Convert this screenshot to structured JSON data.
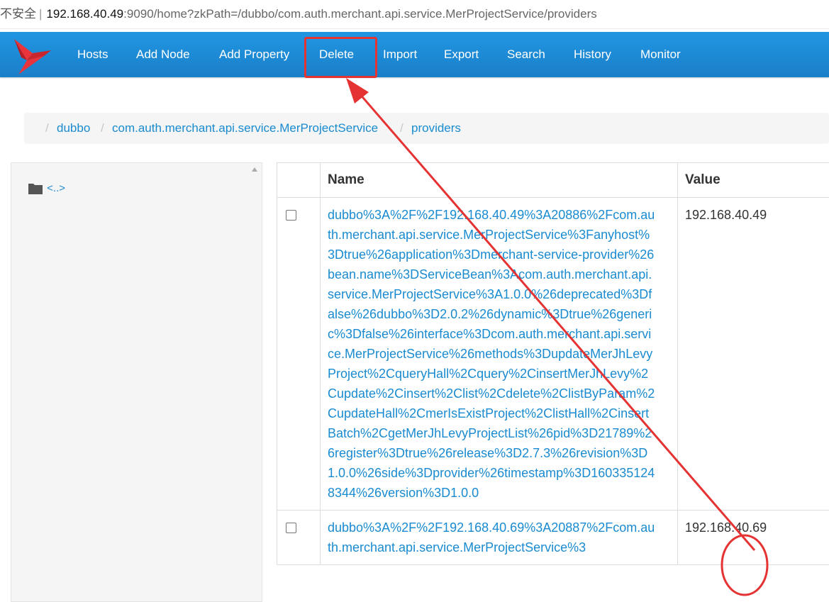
{
  "address_bar": {
    "security_label": "不安全",
    "host": "192.168.40.49",
    "rest": ":9090/home?zkPath=/dubbo/com.auth.merchant.api.service.MerProjectService/providers"
  },
  "nav": {
    "items": [
      {
        "label": "Hosts"
      },
      {
        "label": "Add Node"
      },
      {
        "label": "Add Property"
      },
      {
        "label": "Delete"
      },
      {
        "label": "Import"
      },
      {
        "label": "Export"
      },
      {
        "label": "Search"
      },
      {
        "label": "History"
      },
      {
        "label": "Monitor"
      }
    ]
  },
  "breadcrumb": {
    "items": [
      {
        "label": "dubbo"
      },
      {
        "label": "com.auth.merchant.api.service.MerProjectService"
      },
      {
        "label": "providers"
      }
    ]
  },
  "tree": {
    "parent_link": "<..>"
  },
  "table": {
    "headers": {
      "name": "Name",
      "value": "Value"
    },
    "rows": [
      {
        "name": "dubbo%3A%2F%2F192.168.40.49%3A20886%2Fcom.auth.merchant.api.service.MerProjectService%3Fanyhost%3Dtrue%26application%3Dmerchant-service-provider%26bean.name%3DServiceBean%3Acom.auth.merchant.api.service.MerProjectService%3A1.0.0%26deprecated%3Dfalse%26dubbo%3D2.0.2%26dynamic%3Dtrue%26generic%3Dfalse%26interface%3Dcom.auth.merchant.api.service.MerProjectService%26methods%3DupdateMerJhLevyProject%2CqueryHall%2Cquery%2CinsertMerJhLevy%2Cupdate%2Cinsert%2Clist%2Cdelete%2ClistByParam%2CupdateHall%2CmerIsExistProject%2ClistHall%2CinsertBatch%2CgetMerJhLevyProjectList%26pid%3D21789%26register%3Dtrue%26release%3D2.7.3%26revision%3D1.0.0%26side%3Dprovider%26timestamp%3D1603351248344%26version%3D1.0.0",
        "value": "192.168.40.49"
      },
      {
        "name": "dubbo%3A%2F%2F192.168.40.69%3A20887%2Fcom.auth.merchant.api.service.MerProjectService%3",
        "value": "192.168.40.69"
      }
    ]
  },
  "colors": {
    "navbar": "#1f8fdc",
    "link": "#1a8bd0",
    "annotation": "#e53333"
  }
}
